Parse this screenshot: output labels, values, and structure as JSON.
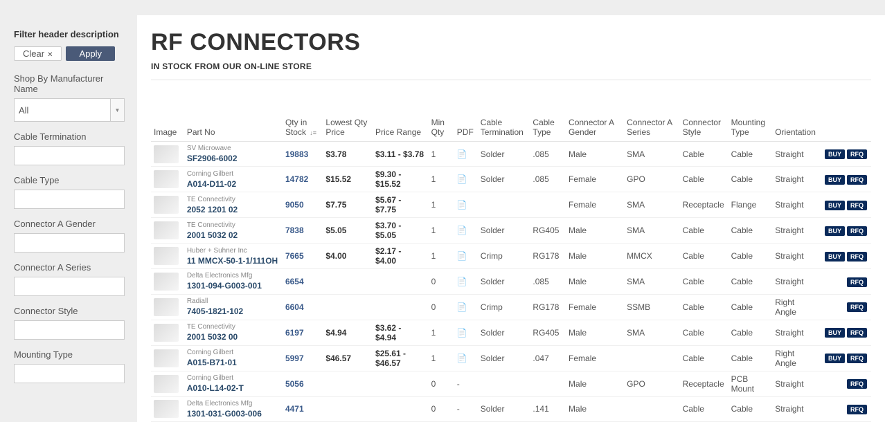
{
  "page": {
    "title": "RF CONNECTORS",
    "subtitle": "IN STOCK FROM OUR ON-LINE STORE"
  },
  "sidebar": {
    "title": "Filter header description",
    "clear_label": "Clear",
    "apply_label": "Apply",
    "filters": [
      {
        "label": "Shop By Manufacturer Name",
        "type": "select",
        "value": "All"
      },
      {
        "label": "Cable Termination",
        "type": "input",
        "value": ""
      },
      {
        "label": "Cable Type",
        "type": "input",
        "value": ""
      },
      {
        "label": "Connector A Gender",
        "type": "input",
        "value": ""
      },
      {
        "label": "Connector A Series",
        "type": "input",
        "value": ""
      },
      {
        "label": "Connector Style",
        "type": "input",
        "value": ""
      },
      {
        "label": "Mounting Type",
        "type": "input",
        "value": ""
      }
    ]
  },
  "table": {
    "headers": {
      "image": "Image",
      "part": "Part No",
      "qty": "Qty in Stock",
      "lowest": "Lowest Qty Price",
      "range": "Price Range",
      "min": "Min Qty",
      "pdf": "PDF",
      "term": "Cable Termination",
      "ctype": "Cable Type",
      "gender": "Connector A Gender",
      "series": "Connector A Series",
      "style": "Connector Style",
      "mount": "Mounting Type",
      "orient": "Orientation"
    },
    "buy_label": "BUY",
    "rfq_label": "RFQ",
    "rows": [
      {
        "mfg": "SV Microwave",
        "part": "SF2906-6002",
        "qty": "19883",
        "lowest": "$3.78",
        "range": "$3.11 - $3.78",
        "min": "1",
        "pdf": true,
        "term": "Solder",
        "ctype": ".085",
        "gender": "Male",
        "series": "SMA",
        "style": "Cable",
        "mount": "Cable",
        "orient": "Straight",
        "buy": true,
        "rfq": true
      },
      {
        "mfg": "Corning Gilbert",
        "part": "A014-D11-02",
        "qty": "14782",
        "lowest": "$15.52",
        "range": "$9.30 - $15.52",
        "min": "1",
        "pdf": true,
        "term": "Solder",
        "ctype": ".085",
        "gender": "Female",
        "series": "GPO",
        "style": "Cable",
        "mount": "Cable",
        "orient": "Straight",
        "buy": true,
        "rfq": true
      },
      {
        "mfg": "TE Connectivity",
        "part": "2052 1201 02",
        "qty": "9050",
        "lowest": "$7.75",
        "range": "$5.67 - $7.75",
        "min": "1",
        "pdf": true,
        "term": "",
        "ctype": "",
        "gender": "Female",
        "series": "SMA",
        "style": "Receptacle",
        "mount": "Flange",
        "orient": "Straight",
        "buy": true,
        "rfq": true
      },
      {
        "mfg": "TE Connectivity",
        "part": "2001 5032 02",
        "qty": "7838",
        "lowest": "$5.05",
        "range": "$3.70 - $5.05",
        "min": "1",
        "pdf": true,
        "term": "Solder",
        "ctype": "RG405",
        "gender": "Male",
        "series": "SMA",
        "style": "Cable",
        "mount": "Cable",
        "orient": "Straight",
        "buy": true,
        "rfq": true
      },
      {
        "mfg": "Huber + Suhner Inc",
        "part": "11 MMCX-50-1-1/111OH",
        "qty": "7665",
        "lowest": "$4.00",
        "range": "$2.17 - $4.00",
        "min": "1",
        "pdf": true,
        "term": "Crimp",
        "ctype": "RG178",
        "gender": "Male",
        "series": "MMCX",
        "style": "Cable",
        "mount": "Cable",
        "orient": "Straight",
        "buy": true,
        "rfq": true
      },
      {
        "mfg": "Delta Electronics Mfg",
        "part": "1301-094-G003-001",
        "qty": "6654",
        "lowest": "",
        "range": "",
        "min": "0",
        "pdf": true,
        "term": "Solder",
        "ctype": ".085",
        "gender": "Male",
        "series": "SMA",
        "style": "Cable",
        "mount": "Cable",
        "orient": "Straight",
        "buy": false,
        "rfq": true
      },
      {
        "mfg": "Radiall",
        "part": "7405-1821-102",
        "qty": "6604",
        "lowest": "",
        "range": "",
        "min": "0",
        "pdf": true,
        "term": "Crimp",
        "ctype": "RG178",
        "gender": "Female",
        "series": "SSMB",
        "style": "Cable",
        "mount": "Cable",
        "orient": "Right Angle",
        "buy": false,
        "rfq": true
      },
      {
        "mfg": "TE Connectivity",
        "part": "2001 5032 00",
        "qty": "6197",
        "lowest": "$4.94",
        "range": "$3.62 - $4.94",
        "min": "1",
        "pdf": true,
        "term": "Solder",
        "ctype": "RG405",
        "gender": "Male",
        "series": "SMA",
        "style": "Cable",
        "mount": "Cable",
        "orient": "Straight",
        "buy": true,
        "rfq": true
      },
      {
        "mfg": "Corning Gilbert",
        "part": "A015-B71-01",
        "qty": "5997",
        "lowest": "$46.57",
        "range": "$25.61 - $46.57",
        "min": "1",
        "pdf": true,
        "term": "Solder",
        "ctype": ".047",
        "gender": "Female",
        "series": "",
        "style": "Cable",
        "mount": "Cable",
        "orient": "Right Angle",
        "buy": true,
        "rfq": true
      },
      {
        "mfg": "Corning Gilbert",
        "part": "A010-L14-02-T",
        "qty": "5056",
        "lowest": "",
        "range": "",
        "min": "0",
        "pdf": false,
        "term": "",
        "ctype": "",
        "gender": "Male",
        "series": "GPO",
        "style": "Receptacle",
        "mount": "PCB Mount",
        "orient": "Straight",
        "buy": false,
        "rfq": true
      },
      {
        "mfg": "Delta Electronics Mfg",
        "part": "1301-031-G003-006",
        "qty": "4471",
        "lowest": "",
        "range": "",
        "min": "0",
        "pdf": false,
        "term": "Solder",
        "ctype": ".141",
        "gender": "Male",
        "series": "",
        "style": "Cable",
        "mount": "Cable",
        "orient": "Straight",
        "buy": false,
        "rfq": true
      }
    ]
  }
}
